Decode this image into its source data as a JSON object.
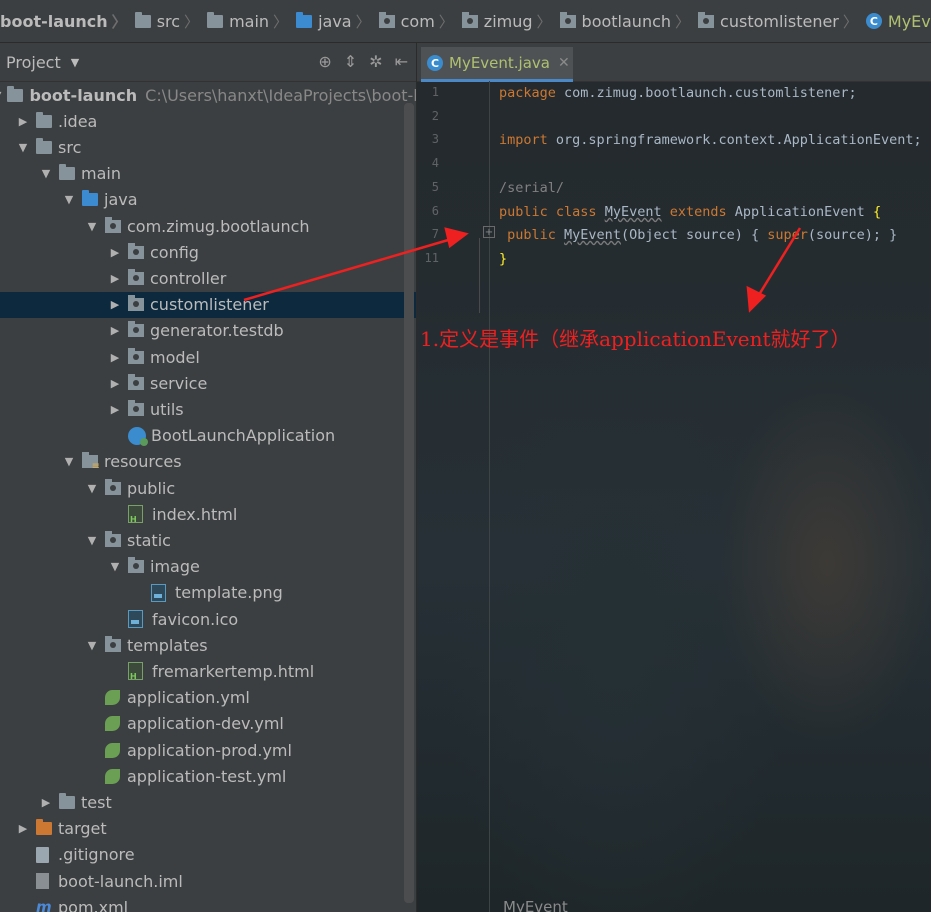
{
  "breadcrumb": [
    {
      "label": "boot-launch",
      "icon": "folder-icon"
    },
    {
      "label": "src",
      "icon": "folder-icon"
    },
    {
      "label": "main",
      "icon": "folder-icon"
    },
    {
      "label": "java",
      "icon": "folder-icon"
    },
    {
      "label": "com",
      "icon": "package-icon"
    },
    {
      "label": "zimug",
      "icon": "package-icon"
    },
    {
      "label": "bootlaunch",
      "icon": "package-icon"
    },
    {
      "label": "customlistener",
      "icon": "package-icon"
    },
    {
      "label": "MyEvent",
      "icon": "class-icon"
    }
  ],
  "project_panel": {
    "title": "Project",
    "tree": [
      {
        "label": "boot-launch",
        "extra": "C:\\Users\\hanxt\\IdeaProjects\\boot-launch",
        "depth": 0,
        "icon": "module-folder",
        "arrow": "down",
        "bold": true
      },
      {
        "label": ".idea",
        "depth": 1,
        "icon": "folder",
        "arrow": "right"
      },
      {
        "label": "src",
        "depth": 1,
        "icon": "folder",
        "arrow": "down"
      },
      {
        "label": "main",
        "depth": 2,
        "icon": "folder",
        "arrow": "down"
      },
      {
        "label": "java",
        "depth": 3,
        "icon": "folder-blue",
        "arrow": "down"
      },
      {
        "label": "com.zimug.bootlaunch",
        "depth": 4,
        "icon": "pkg",
        "arrow": "down"
      },
      {
        "label": "config",
        "depth": 5,
        "icon": "pkg",
        "arrow": "right"
      },
      {
        "label": "controller",
        "depth": 5,
        "icon": "pkg",
        "arrow": "right"
      },
      {
        "label": "customlistener",
        "depth": 5,
        "icon": "pkg",
        "arrow": "right",
        "selected": true
      },
      {
        "label": "generator.testdb",
        "depth": 5,
        "icon": "pkg",
        "arrow": "right"
      },
      {
        "label": "model",
        "depth": 5,
        "icon": "pkg",
        "arrow": "right"
      },
      {
        "label": "service",
        "depth": 5,
        "icon": "pkg",
        "arrow": "right"
      },
      {
        "label": "utils",
        "depth": 5,
        "icon": "pkg",
        "arrow": "right"
      },
      {
        "label": "BootLaunchApplication",
        "depth": 5,
        "icon": "cls",
        "arrow": ""
      },
      {
        "label": "resources",
        "depth": 3,
        "icon": "res",
        "arrow": "down"
      },
      {
        "label": "public",
        "depth": 4,
        "icon": "pkg",
        "arrow": "down"
      },
      {
        "label": "index.html",
        "depth": 5,
        "icon": "html",
        "arrow": ""
      },
      {
        "label": "static",
        "depth": 4,
        "icon": "pkg",
        "arrow": "down"
      },
      {
        "label": "image",
        "depth": 5,
        "icon": "pkg",
        "arrow": "down"
      },
      {
        "label": "template.png",
        "depth": 6,
        "icon": "img",
        "arrow": ""
      },
      {
        "label": "favicon.ico",
        "depth": 5,
        "icon": "img",
        "arrow": ""
      },
      {
        "label": "templates",
        "depth": 4,
        "icon": "pkg",
        "arrow": "down"
      },
      {
        "label": "fremarkertemp.html",
        "depth": 5,
        "icon": "html",
        "arrow": ""
      },
      {
        "label": "application.yml",
        "depth": 4,
        "icon": "yml",
        "arrow": ""
      },
      {
        "label": "application-dev.yml",
        "depth": 4,
        "icon": "yml",
        "arrow": ""
      },
      {
        "label": "application-prod.yml",
        "depth": 4,
        "icon": "yml",
        "arrow": ""
      },
      {
        "label": "application-test.yml",
        "depth": 4,
        "icon": "yml",
        "arrow": ""
      },
      {
        "label": "test",
        "depth": 2,
        "icon": "folder",
        "arrow": "right"
      },
      {
        "label": "target",
        "depth": 1,
        "icon": "folder-orange",
        "arrow": "right"
      },
      {
        "label": ".gitignore",
        "depth": 1,
        "icon": "file",
        "arrow": ""
      },
      {
        "label": "boot-launch.iml",
        "depth": 1,
        "icon": "iml",
        "arrow": ""
      },
      {
        "label": "pom.xml",
        "depth": 1,
        "icon": "mvn",
        "arrow": ""
      }
    ]
  },
  "editor": {
    "tab_label": "MyEvent.java",
    "line_numbers": [
      "1",
      "2",
      "3",
      "4",
      "5",
      "6",
      "7",
      "11"
    ],
    "code": {
      "l1_kw": "package",
      "l1_rest": " com.zimug.bootlaunch.customlistener;",
      "l3_kw": "import",
      "l3_rest": " org.springframework.context.ApplicationEvent;",
      "l5": "/serial/",
      "l6_kw1": "public class",
      "l6_name": "MyEvent",
      "l6_kw2": "extends",
      "l6_rest": " ApplicationEvent ",
      "l6_brace": "{",
      "l7_kw": " public",
      "l7_name": "MyEvent",
      "l7_rest": "(Object source) { ",
      "l7_super": "super",
      "l7_end": "(source); }",
      "l11": "}"
    },
    "annotation": "1.定义是事件（继承applicationEvent就好了）",
    "status_file": "MyEvent"
  },
  "colors": {
    "annotation": "#ee2020",
    "keyword": "#cc7832",
    "selection": "#0d293e",
    "tab_underline": "#4a88c7"
  }
}
